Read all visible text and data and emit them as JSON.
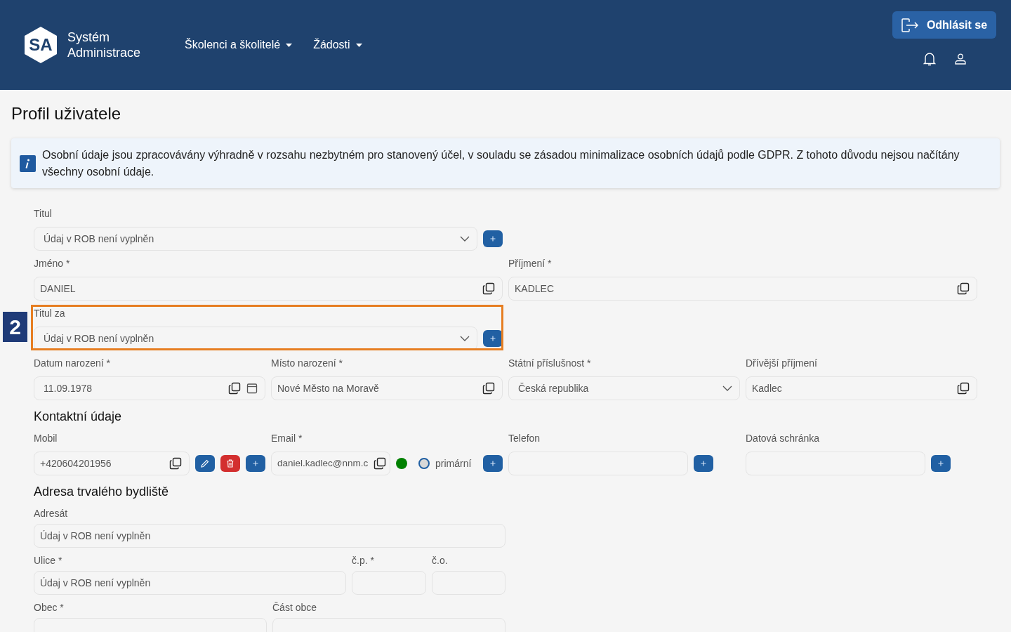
{
  "header": {
    "logo": {
      "initials": "SA",
      "name_lines": [
        "Systém",
        "Administrace"
      ]
    },
    "nav": [
      {
        "label": "Školenci a školitelé"
      },
      {
        "label": "Žádosti"
      }
    ],
    "logout": "Odhlásit se"
  },
  "page_title": "Profil uživatele",
  "info": "Osobní údaje jsou zpracovávány výhradně v rozsahu nezbytném pro stanovený účel, v souladu se zásadou minimalizace osobních údajů podle GDPR. Z tohoto důvodu nejsou načítány všechny osobní údaje.",
  "personal_rows": [
    [
      {
        "label": "Titul",
        "value": "Údaj v ROB není vyplněn",
        "kind": "select",
        "add": true
      }
    ],
    [
      {
        "label": "Jméno *",
        "value": "DANIEL",
        "kind": "text",
        "copy": true
      },
      {
        "label": "Příjmení *",
        "value": "KADLEC",
        "kind": "text",
        "copy": true
      }
    ],
    [
      {
        "label": "Titul za",
        "value": "Údaj v ROB není vyplněn",
        "kind": "select",
        "add": true,
        "annotation": "2"
      }
    ],
    [
      {
        "label": "Datum narození *",
        "value": "11.09.1978",
        "kind": "date",
        "copy": true
      },
      {
        "label": "Místo narození *",
        "value": "Nové Město na Moravě",
        "kind": "text",
        "copy": true
      },
      {
        "label": "Státní příslušnost *",
        "value": "Česká republika",
        "kind": "select"
      },
      {
        "label": "Dřívější příjmení",
        "value": "Kadlec",
        "kind": "text",
        "copy": true
      }
    ]
  ],
  "contacts": {
    "title": "Kontaktní údaje",
    "mobile": {
      "label": "Mobil",
      "value": "+420604201956",
      "copy": true,
      "edit": true,
      "delete": true,
      "add": true
    },
    "email": {
      "label": "Email *",
      "value": "daniel.kadlec@nnm.c",
      "copy": true,
      "color": "#008000",
      "primary": {
        "label": "primární",
        "checked": false
      },
      "add": true
    },
    "phone": {
      "label": "Telefon",
      "add": true
    },
    "databox": {
      "label": "Datová schránka",
      "add": true
    }
  },
  "address": {
    "title": "Adresa trvalého bydliště",
    "rows": [
      [
        {
          "label": "Adresát",
          "value": "Údaj v ROB není vyplněn"
        }
      ],
      [
        {
          "label": "Ulice *",
          "value": "Údaj v ROB není vyplněn"
        },
        {
          "label": "č.p. *"
        },
        {
          "label": "č.o."
        }
      ],
      [
        {
          "label": "Obec *"
        },
        {
          "label": "Část obce"
        }
      ]
    ]
  }
}
